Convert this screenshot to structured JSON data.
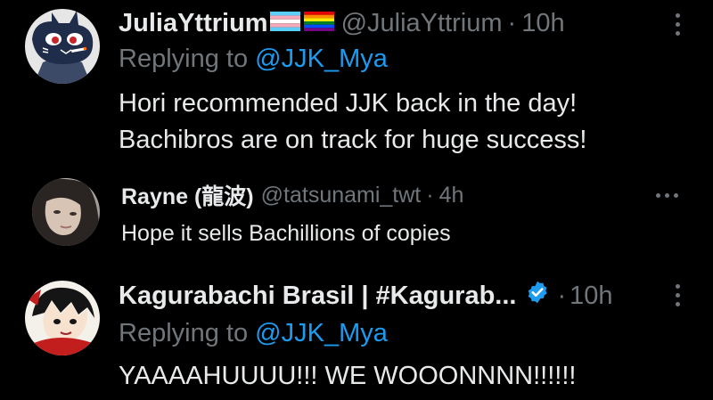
{
  "replies": [
    {
      "display_name": "JuliaYttrium",
      "handle": "@JuliaYttrium",
      "separator": "·",
      "time": "10h",
      "replying_prefix": "Replying to",
      "replying_to": "@JJK_Mya",
      "text": "Hori recommended JJK back in the day!\nBachibros are on track for huge success!",
      "flags": [
        "transgender-flag-icon",
        "rainbow-flag-icon"
      ],
      "avatar": "cartoon-cat-avatar"
    },
    {
      "display_name": "Rayne (龍波)",
      "handle": "@tatsunami_twt",
      "separator": "·",
      "time": "4h",
      "text": "Hope it sells Bachillions of copies",
      "avatar": "photo-avatar"
    },
    {
      "display_name": "Kagurabachi Brasil | #Kagurab...",
      "handle": "",
      "separator": "·",
      "time": "10h",
      "verified": true,
      "replying_prefix": "Replying to",
      "replying_to": "@JJK_Mya",
      "text": "YAAAAHUUUU!!! WE WOOONNNN!!!!!!",
      "avatar": "manga-character-avatar"
    }
  ],
  "colors": {
    "background": "#000000",
    "primary_text": "#e7e9ea",
    "secondary_text": "#71767b",
    "accent": "#1d9bf0"
  }
}
